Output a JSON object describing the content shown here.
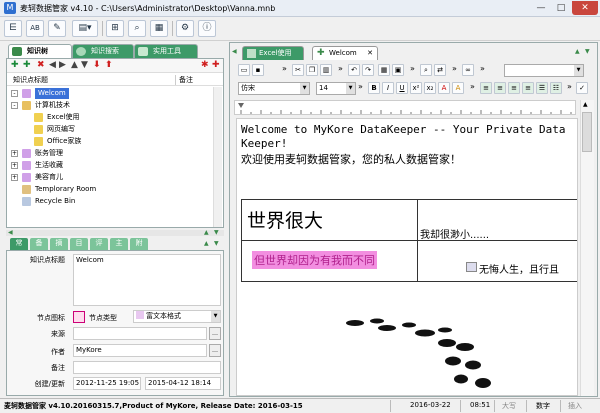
{
  "window": {
    "title": "麦轲数据管家 v4.10 - C:\\Users\\Administrator\\Desktop\\Vanna.mnb",
    "minimize": "—",
    "maximize": "□",
    "close": "✕"
  },
  "left_tabs": [
    "知识树",
    "知识搜索",
    "实用工具"
  ],
  "tree": {
    "header_title": "知识点标题",
    "header_note": "备注",
    "nodes": [
      {
        "label": "Welcom",
        "level": 1,
        "expand": "-",
        "selected": true
      },
      {
        "label": "计算机技术",
        "level": 1,
        "expand": "-"
      },
      {
        "label": "Excel使用",
        "level": 2,
        "expand": ""
      },
      {
        "label": "网页编写",
        "level": 2,
        "expand": ""
      },
      {
        "label": "Office家族",
        "level": 2,
        "expand": ""
      },
      {
        "label": "账务管理",
        "level": 1,
        "expand": "+"
      },
      {
        "label": "生活收藏",
        "level": 1,
        "expand": "+"
      },
      {
        "label": "美容育儿",
        "level": 1,
        "expand": "+"
      },
      {
        "label": "Templorary Room",
        "level": 1,
        "expand": ""
      },
      {
        "label": "Recycle Bin",
        "level": 1,
        "expand": ""
      }
    ]
  },
  "prop_tabs": [
    "常",
    "备",
    "摘",
    "目",
    "评",
    "主",
    "附"
  ],
  "props": {
    "title_label": "知识点标题",
    "title_value": "Welcom",
    "icon_label": "节点图标",
    "type_label": "节点类型",
    "type_value": "富文本格式",
    "source_label": "来源",
    "source_value": "",
    "author_label": "作者",
    "author_value": "MyKore",
    "note_label": "备注",
    "note_value": "",
    "date_label": "创建/更新",
    "created": "2012-11-25 19:05",
    "updated": "2015-04-12 18:14"
  },
  "editor_tabs": [
    "Excel使用",
    "Welcom"
  ],
  "editor": {
    "font": "仿宋",
    "size": "14",
    "line1": "Welcome to MyKore DataKeeper -- Your Private Data",
    "line2": "Keeper!",
    "line3": "欢迎使用麦轲数据管家，您的私人数据管家！",
    "cell_big": "世界很大",
    "cell_small": "我却很渺小......",
    "cell_pink": "但世界却因为有我而不同",
    "cell_motto": "无悔人生，且行且"
  },
  "status": {
    "left": "麦轲数据管家 v4.10.20160315.7,Product of MyKore, Release Date: 2016-03-15",
    "date": "2016-03-22",
    "time": "08:51",
    "caps": "大写",
    "num": "数字",
    "ins": "插入"
  },
  "colors": {
    "tab_green": "#3d9a68",
    "pink_highlight": "#f28ee0",
    "pink_text": "#b0208c",
    "tree_selected": "#3a71d8"
  }
}
